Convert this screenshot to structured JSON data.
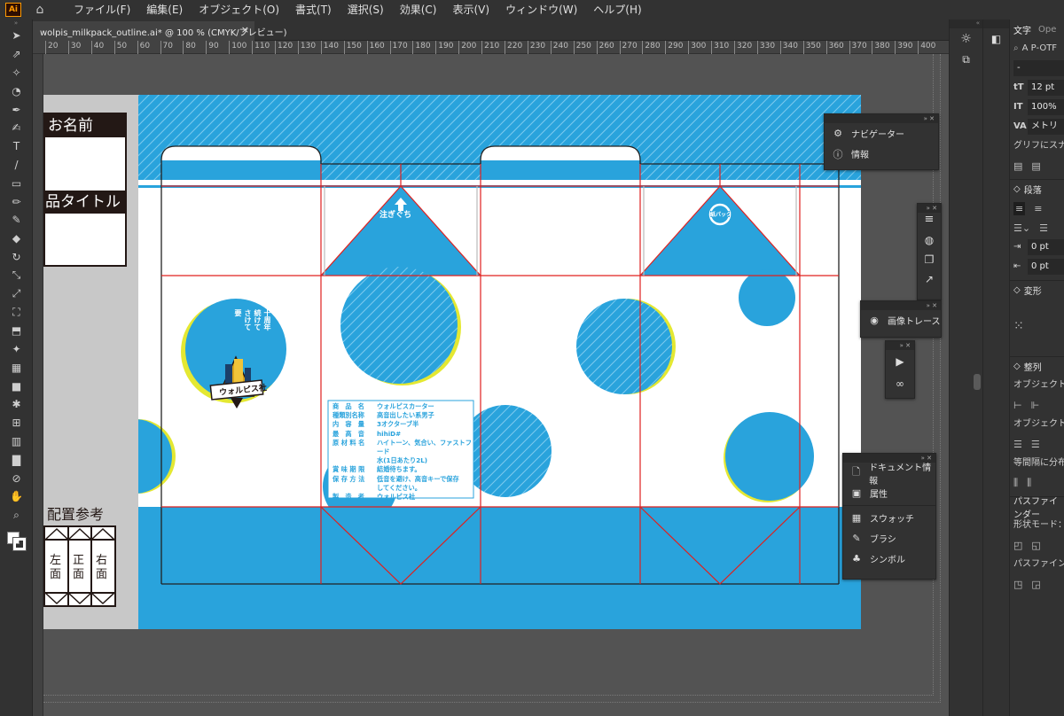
{
  "menu": {
    "logo": "Ai",
    "items": [
      "ファイル(F)",
      "編集(E)",
      "オブジェクト(O)",
      "書式(T)",
      "選択(S)",
      "効果(C)",
      "表示(V)",
      "ウィンドウ(W)",
      "ヘルプ(H)"
    ]
  },
  "document": {
    "tab_title": "wolpis_milkpack_outline.ai* @ 100 % (CMYK/プレビュー)",
    "close": "×"
  },
  "ruler": {
    "ticks": [
      "20",
      "30",
      "40",
      "50",
      "60",
      "70",
      "80",
      "90",
      "100",
      "110",
      "120",
      "130",
      "140",
      "150",
      "160",
      "170",
      "180",
      "190",
      "200",
      "210",
      "220",
      "230",
      "240",
      "250",
      "260",
      "270",
      "280",
      "290",
      "300",
      "310",
      "320",
      "330",
      "340",
      "350",
      "360",
      "370",
      "380",
      "390",
      "400"
    ]
  },
  "artboard": {
    "name_label": "お名前",
    "title_label": "品タイトル",
    "layout_label": "配置参考",
    "faces": [
      "左面",
      "正面",
      "右面"
    ],
    "spout_label": "注ぎぐち",
    "recycle_label": "紙パック",
    "emblem_text": [
      "十周年",
      "続けて",
      "さけて",
      "要"
    ],
    "emblem_brand": "ウォルピス社",
    "label_rows": [
      {
        "k": "商　品　名",
        "v": "ウォルピスカーター"
      },
      {
        "k": "種類別名称",
        "v": "高音出したい系男子"
      },
      {
        "k": "内　容　量",
        "v": "3オクターブ半"
      },
      {
        "k": "最　高　音",
        "v": "hihiD#"
      },
      {
        "k": "原 材 料 名",
        "v": "ハイトーン、気合い、ファストフード"
      },
      {
        "k": "",
        "v": "水(1日あたり2L)"
      },
      {
        "k": "賞 味 期 限",
        "v": "結婚待ちます。"
      },
      {
        "k": "保 存 方 法",
        "v": "低音を避け、高音キーで保存"
      },
      {
        "k": "",
        "v": "してください。"
      },
      {
        "k": "製　造　者",
        "v": "ウォルピス社"
      }
    ],
    "colors": {
      "blue": "#29a3dc",
      "cut": "#e0201e",
      "fold": "#222222",
      "paper": "#ffffff"
    }
  },
  "panels": {
    "navigator": {
      "items": [
        "ナビゲーター",
        "情報"
      ]
    },
    "trace": {
      "items": [
        "画像トレース"
      ]
    },
    "document_info": {
      "items": [
        "ドキュメント情報",
        "属性"
      ]
    },
    "swatch_group": {
      "items": [
        "スウォッチ",
        "ブラシ",
        "シンボル"
      ]
    }
  },
  "props": {
    "tab_text": "文字",
    "tab_other": "Ope",
    "font_name": "A P-OTF",
    "font_style": "-",
    "size": "12 pt",
    "scale": "100%",
    "tracking": "メトリ",
    "glyph_label": "グリフにスナ",
    "paragraph": "段落",
    "indent1": "0 pt",
    "indent2": "0 pt",
    "transform": "変形",
    "align": "整列",
    "align_obj": "オブジェクト",
    "align_obj2": "オブジェクト",
    "distribute": "等間隔に分布",
    "pathfinder": "パスファインダー",
    "shape_mode": "形状モード：",
    "pathfinder2": "パスファイン"
  }
}
